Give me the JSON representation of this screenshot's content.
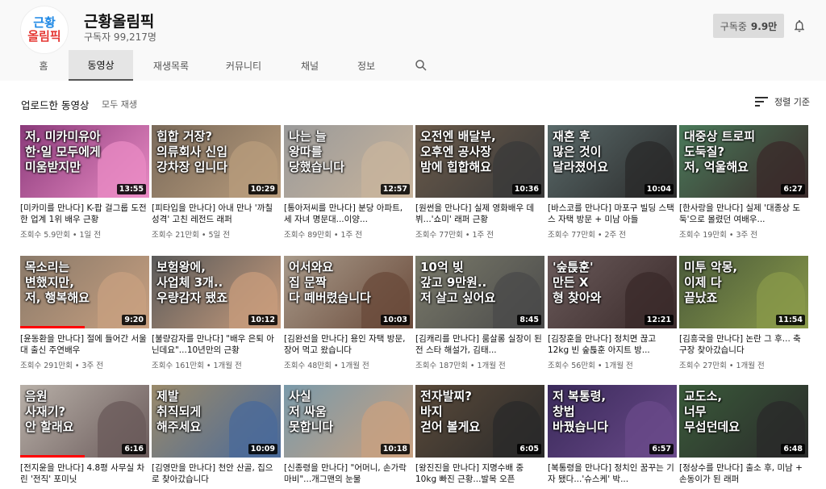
{
  "channel": {
    "avatar_line1": "근황",
    "avatar_line2": "올림픽",
    "name": "근황올림픽",
    "subscribers": "구독자 99,217명",
    "subscribe_label": "구독중",
    "subscribe_count": "9.9만"
  },
  "tabs": [
    {
      "label": "홈"
    },
    {
      "label": "동영상"
    },
    {
      "label": "재생목록"
    },
    {
      "label": "커뮤니티"
    },
    {
      "label": "채널"
    },
    {
      "label": "정보"
    }
  ],
  "active_tab": "동영상",
  "shelf": {
    "title": "업로드한 동영상",
    "play_all": "모두 재생",
    "sort_label": "정렬 기준"
  },
  "videos": [
    {
      "caption": "저, 미카미유아\n한·일 모두에게\n미움받지만",
      "duration": "13:55",
      "title": "[미카미를 만나다] K-팝 걸그룹 도전한 업계 1위 배우 근황",
      "meta": "조회수 5.9만회 • 1일 전",
      "bg": "#8a3a7a",
      "accent": "#e98bc4",
      "progress": 0
    },
    {
      "caption": "힙합 거장?\n의류회사 신입\n강차장 입니다",
      "duration": "10:29",
      "title": "[피타입을 만나다] 아내 만나 '까칠 성격' 고친 레전드 래퍼",
      "meta": "조회수 21만회 • 5일 전",
      "bg": "#7a6a5a",
      "accent": "#b89c7c",
      "progress": 0
    },
    {
      "caption": "나는 늘\n왕따를\n당했습니다",
      "duration": "12:57",
      "title": "[통아저씨를 만나다] 분당 아파트, 세 자녀 명문대...이양...",
      "meta": "조회수 89만회 • 1주 전",
      "bg": "#9a9a9a",
      "accent": "#c8b49c",
      "progress": 0
    },
    {
      "caption": "오전엔 배달부,\n오후엔 공사장\n밤에 힙합해요",
      "duration": "10:36",
      "title": "[원썬을 만나다] 실제 영화배우 데뷔...'쇼미' 래퍼 근황",
      "meta": "조회수 77만회 • 1주 전",
      "bg": "#6a5a4a",
      "accent": "#3a3a3a",
      "progress": 0
    },
    {
      "caption": "재혼 후\n많은 것이\n달라졌어요",
      "duration": "10:04",
      "title": "[바스코를 만나다] 마포구 빌딩 스택스 자택 방문 + 미남 아들",
      "meta": "조회수 77만회 • 2주 전",
      "bg": "#5a6a6a",
      "accent": "#2a2a2a",
      "progress": 0
    },
    {
      "caption": "대중상 트로피\n도둑질?\n저, 억울해요",
      "duration": "6:27",
      "title": "[한사랑을 만나다] 실제 '대종상 도둑'으로 몰렸던 여배우...",
      "meta": "조회수 19만회 • 3주 전",
      "bg": "#4a7a5a",
      "accent": "#3a2a2a",
      "progress": 0
    },
    {
      "caption": "목소리는\n변했지만,\n저, 행복해요",
      "duration": "9:20",
      "title": "[윤동환을 만나다] 절에 들어간 서울대 출신 주연배우",
      "meta": "조회수 291만회 • 3주 전",
      "bg": "#8a7a6a",
      "accent": "#c8a080",
      "progress": 0.5
    },
    {
      "caption": "보험왕에,\n사업체 3개..\n우량감자 됐죠",
      "duration": "10:12",
      "title": "[불량감자를 만나다] \"배우 은퇴 아닌데요\"...10년만의 근황",
      "meta": "조회수 161만회 • 1개월 전",
      "bg": "#5a5a5a",
      "accent": "#c89c7c",
      "progress": 0
    },
    {
      "caption": "어서와요\n집 문짝\n다 떼버렸습니다",
      "duration": "10:03",
      "title": "[김완선을 만나다] 용인 자택 방문, 장어 먹고 왔습니다",
      "meta": "조회수 48만회 • 1개월 전",
      "bg": "#a89a8a",
      "accent": "#6a4a3a",
      "progress": 0
    },
    {
      "caption": "10억 빚\n갚고 9만원..\n저 살고 싶어요",
      "duration": "8:45",
      "title": "[김캐리를 만나다] 룸살롱 실장이 된 전 스타 해설가, 김태...",
      "meta": "조회수 187만회 • 1개월 전",
      "bg": "#7a7a6a",
      "accent": "#4a4a4a",
      "progress": 0
    },
    {
      "caption": "'숲튽훈'\n만든 X\n형 찾아와",
      "duration": "12:21",
      "title": "[김장훈을 만나다] 정치면 끊고 12kg 빈 숲튽훈 아지트 방...",
      "meta": "조회수 56만회 • 1개월 전",
      "bg": "#6a5a5a",
      "accent": "#3a2a2a",
      "progress": 0
    },
    {
      "caption": "미투 악몽,\n이제 다\n끝났죠",
      "duration": "11:54",
      "title": "[김흥국을 만나다] 논란 그 후... 축구장 찾아갔습니다",
      "meta": "조회수 27만회 • 1개월 전",
      "bg": "#4a5a3a",
      "accent": "#8a9a4a",
      "progress": 0
    },
    {
      "caption": "음원\n사재기?\n안 할래요",
      "duration": "6:16",
      "title": "[전지윤을 만나다] 4.8평 사무실 차린 '전직' 포미닛",
      "meta": "",
      "bg": "#b8b0a8",
      "accent": "#6a5a5a",
      "progress": 0.5
    },
    {
      "caption": "제발\n취직되게\n해주세요",
      "duration": "10:09",
      "title": "[김영만을 만나다] 천안 산골, 집으로 찾아갔습니다",
      "meta": "",
      "bg": "#9a8a6a",
      "accent": "#4a6a9a",
      "progress": 0
    },
    {
      "caption": "사실\n저 싸움\n못합니다",
      "duration": "10:18",
      "title": "[신종령을 만나다] \"어머니, 손가락 마비\"...개그맨의 눈물",
      "meta": "",
      "bg": "#7a9aaa",
      "accent": "#c8a080",
      "progress": 0
    },
    {
      "caption": "전자발찌?\n바지\n걷어 볼게요",
      "duration": "6:05",
      "title": "[왕진진을 만나다] 지명수배 중 10kg 빠진 근황...발목 오픈",
      "meta": "",
      "bg": "#5a4a3a",
      "accent": "#2a2a2a",
      "progress": 0
    },
    {
      "caption": "저 복통령,\n창법\n바꿨습니다",
      "duration": "6:57",
      "title": "[복통령을 만나다] 정치인 꿈꾸는 기자 됐다...'슈스케' 박...",
      "meta": "",
      "bg": "#3a2a5a",
      "accent": "#6a4a8a",
      "progress": 0
    },
    {
      "caption": "교도소,\n너무\n무섭던데요",
      "duration": "6:48",
      "title": "[정상수를 만나다] 출소 후, 미남 + 손동이가 된 래퍼",
      "meta": "",
      "bg": "#3a5a3a",
      "accent": "#2a2a2a",
      "progress": 0
    }
  ]
}
